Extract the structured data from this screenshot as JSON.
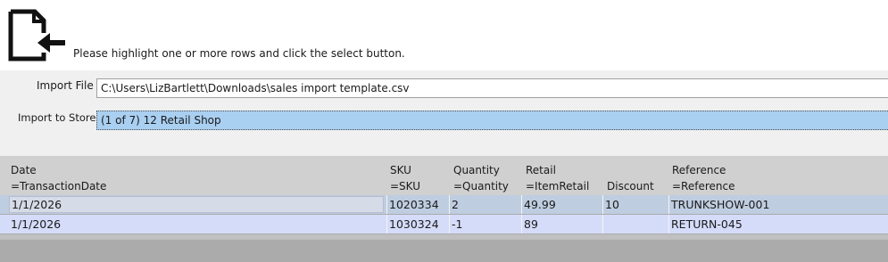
{
  "header": {
    "icon": "document-import-icon",
    "instruction": "Please highlight one or more rows and click the select button."
  },
  "form": {
    "import_file_label": "Import File",
    "import_file_value": "C:\\Users\\LizBartlett\\Downloads\\sales import template.csv",
    "import_to_stores_label": "Import to Stores",
    "import_to_stores_value": "(1 of 7) 12 Retail Shop"
  },
  "grid": {
    "columns": [
      {
        "title": "Date",
        "mapping": "=TransactionDate"
      },
      {
        "title": "SKU",
        "mapping": "=SKU"
      },
      {
        "title": "Quantity",
        "mapping": "=Quantity"
      },
      {
        "title": "Retail",
        "mapping": "=ItemRetail"
      },
      {
        "title": "Discount",
        "mapping": ""
      },
      {
        "title": "Reference",
        "mapping": "=Reference"
      }
    ],
    "rows": [
      [
        "1/1/2026",
        "1020334",
        "2",
        "49.99",
        "10",
        "TRUNKSHOW-001"
      ],
      [
        "1/1/2026",
        "1030324",
        "-1",
        "89",
        "",
        "RETURN-045"
      ]
    ]
  },
  "colors": {
    "selected_store": "#a9cff1",
    "row_1": "#bfcde1",
    "row_2": "#d5dcfa",
    "header_bg": "#d0d0d0"
  }
}
